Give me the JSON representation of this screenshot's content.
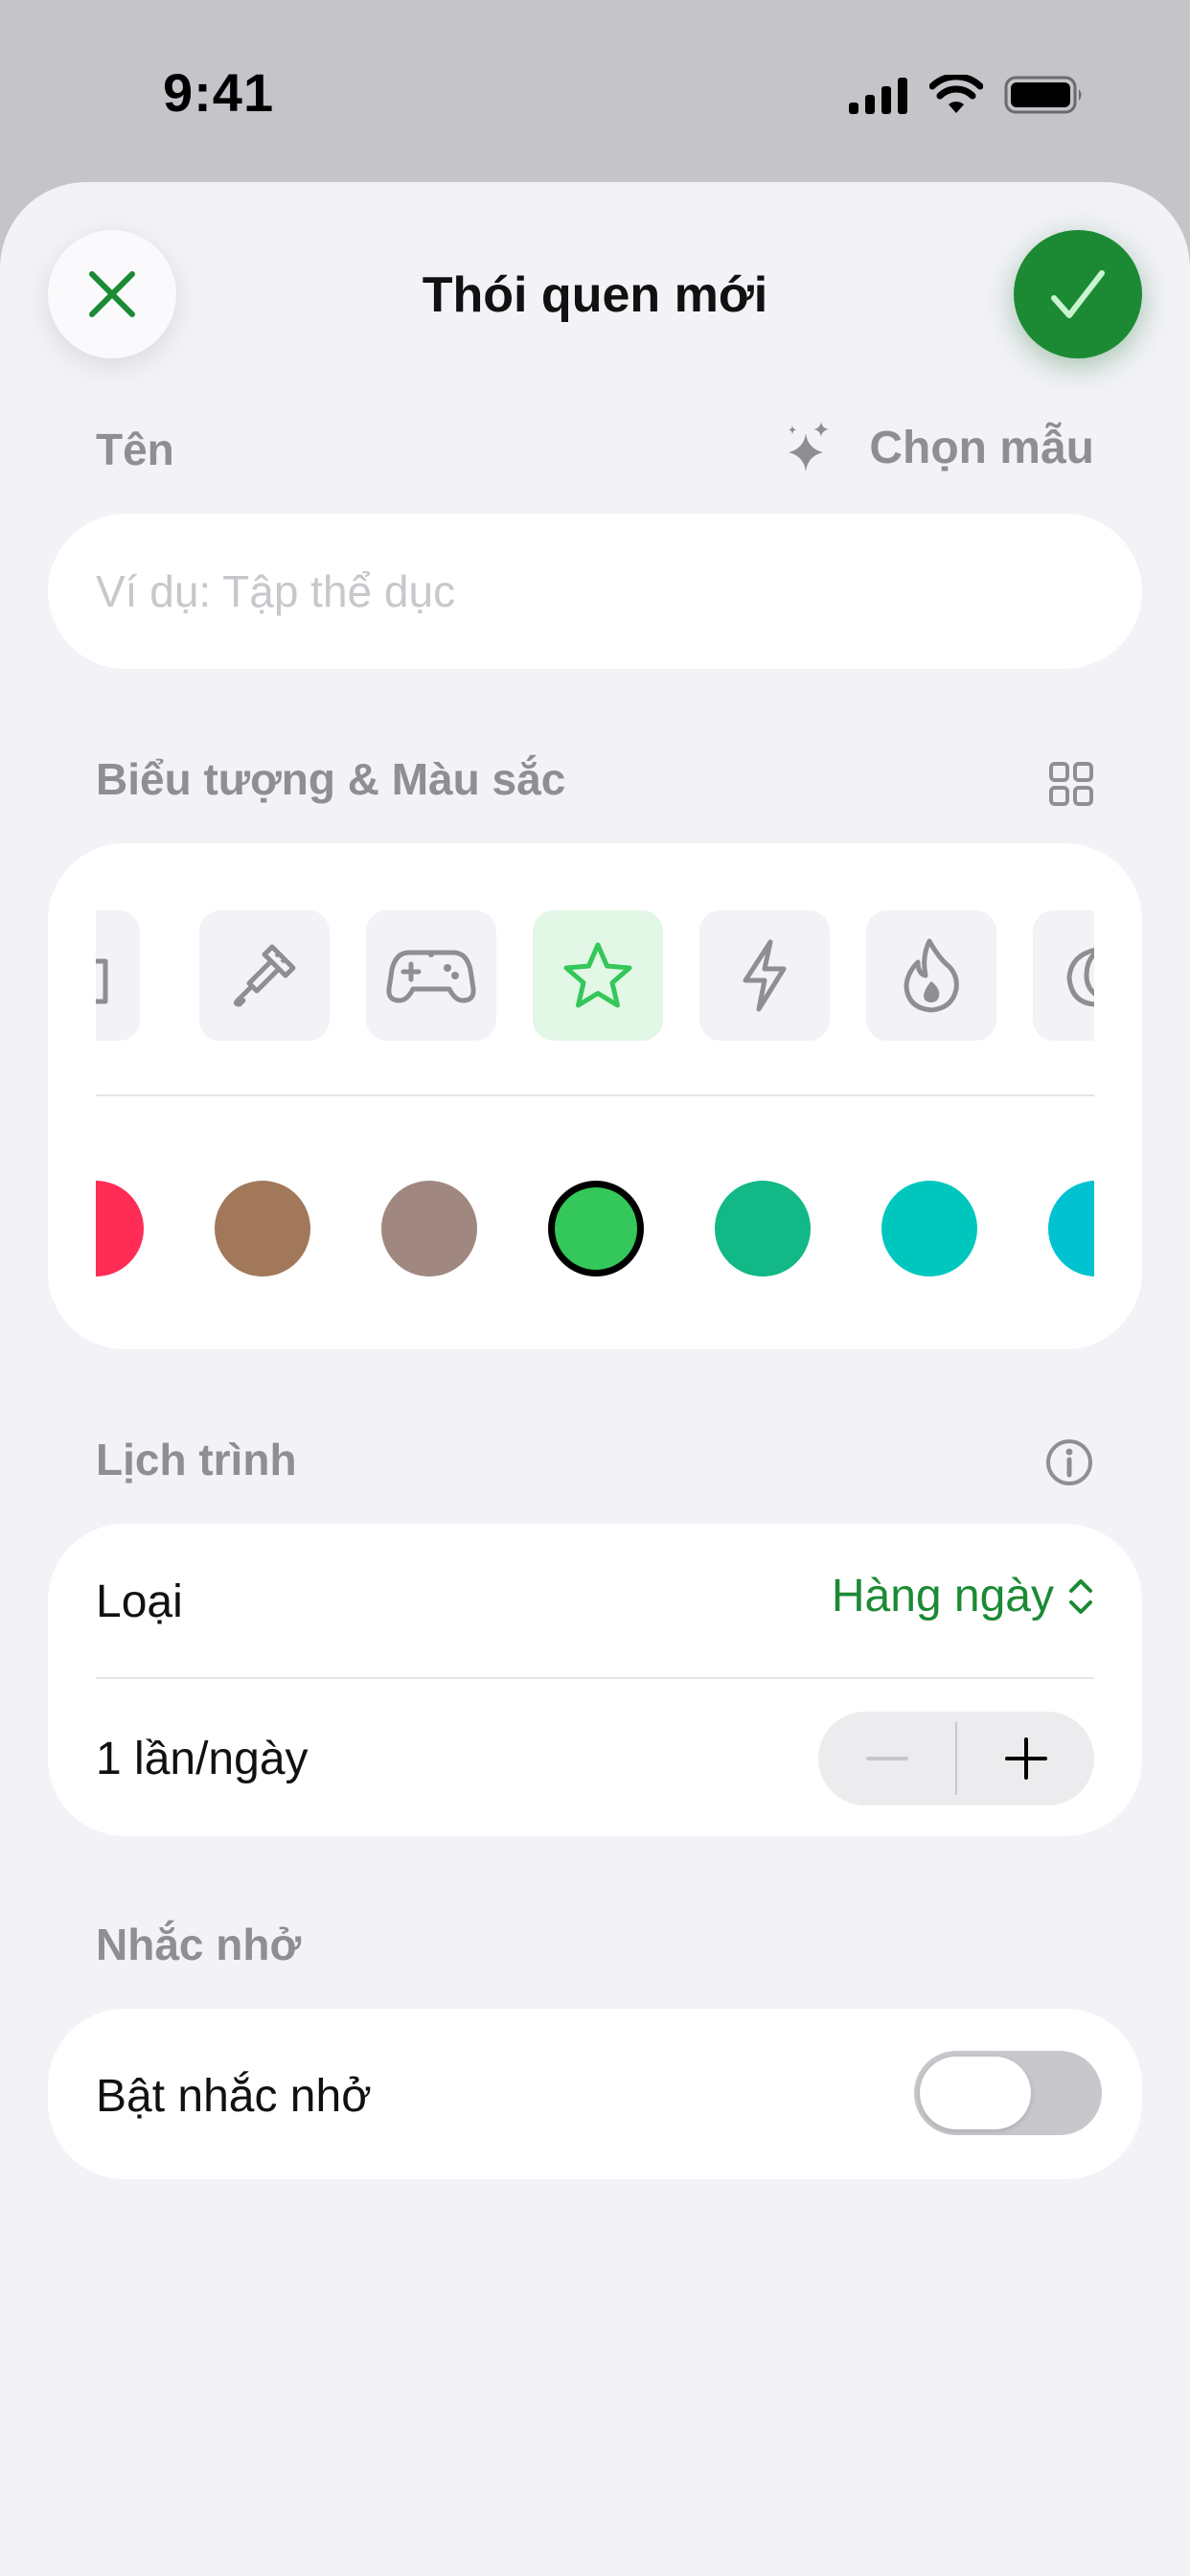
{
  "status_bar": {
    "time": "9:41",
    "icons": [
      "cellular-signal-icon",
      "wifi-icon",
      "battery-icon"
    ]
  },
  "header": {
    "title": "Thói quen mới",
    "close_icon": "close-icon",
    "confirm_icon": "checkmark-icon"
  },
  "name_section": {
    "label": "Tên",
    "template_label": "Chọn mẫu",
    "template_icon": "sparkles-icon",
    "input_value": "",
    "input_placeholder": "Ví dụ: Tập thể dục"
  },
  "appearance_section": {
    "label": "Biểu tượng & Màu sắc",
    "grid_icon": "grid-icon",
    "icons": [
      "camera-icon",
      "paintbrush-icon",
      "gamepad-icon",
      "star-icon",
      "bolt-icon",
      "flame-icon",
      "moon-icon"
    ],
    "selected_icon": "star-icon",
    "colors": [
      "#ff2d55",
      "#a2785a",
      "#a08880",
      "#34c759",
      "#12b886",
      "#00c7be",
      "#00c2d1"
    ],
    "selected_color": "#34c759"
  },
  "schedule_section": {
    "label": "Lịch trình",
    "info_icon": "info-icon",
    "type_label": "Loại",
    "type_value": "Hàng ngày",
    "frequency_label": "1 lần/ngày",
    "frequency_count": 1
  },
  "reminder_section": {
    "label": "Nhắc nhở",
    "toggle_label": "Bật nhắc nhở",
    "enabled": false
  },
  "colors": {
    "accent": "#1c8a34",
    "accent_light": "#34c759",
    "secondary_text": "#8e8e93",
    "sheet_background": "#f2f2f7"
  }
}
